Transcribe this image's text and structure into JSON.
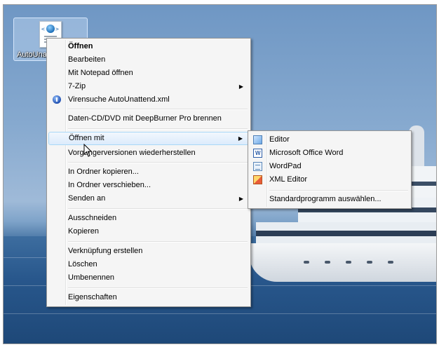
{
  "desktop": {
    "icon_label": "AutoUnattend.xml"
  },
  "context_menu": {
    "items": [
      {
        "label": "Öffnen",
        "bold": true
      },
      {
        "label": "Bearbeiten"
      },
      {
        "label": "Mit Notepad öffnen"
      },
      {
        "label": "7-Zip",
        "submenu": true
      },
      {
        "label": "Virensuche AutoUnattend.xml",
        "icon": "antivirus-icon"
      },
      {
        "label": "Daten-CD/DVD mit DeepBurner Pro brennen"
      },
      {
        "label": "Öffnen mit",
        "submenu": true,
        "highlighted": true
      },
      {
        "label": "Vorgängerversionen wiederherstellen"
      },
      {
        "label": "In Ordner kopieren..."
      },
      {
        "label": "In Ordner verschieben..."
      },
      {
        "label": "Senden an",
        "submenu": true
      },
      {
        "label": "Ausschneiden"
      },
      {
        "label": "Kopieren"
      },
      {
        "label": "Verknüpfung erstellen"
      },
      {
        "label": "Löschen"
      },
      {
        "label": "Umbenennen"
      },
      {
        "label": "Eigenschaften"
      }
    ],
    "arrow": "▶"
  },
  "open_with_submenu": {
    "items": [
      {
        "label": "Editor",
        "icon": "notepad-icon"
      },
      {
        "label": "Microsoft Office Word",
        "icon": "word-icon"
      },
      {
        "label": "WordPad",
        "icon": "wordpad-icon"
      },
      {
        "label": "XML Editor",
        "icon": "xml-editor-icon"
      },
      {
        "label": "Standardprogramm auswählen..."
      }
    ]
  },
  "colors": {
    "menu_bg": "#f5f5f5",
    "highlight_border": "#a8d8f7",
    "desktop_sky": "#86a9cf",
    "desktop_sea": "#28578c"
  }
}
